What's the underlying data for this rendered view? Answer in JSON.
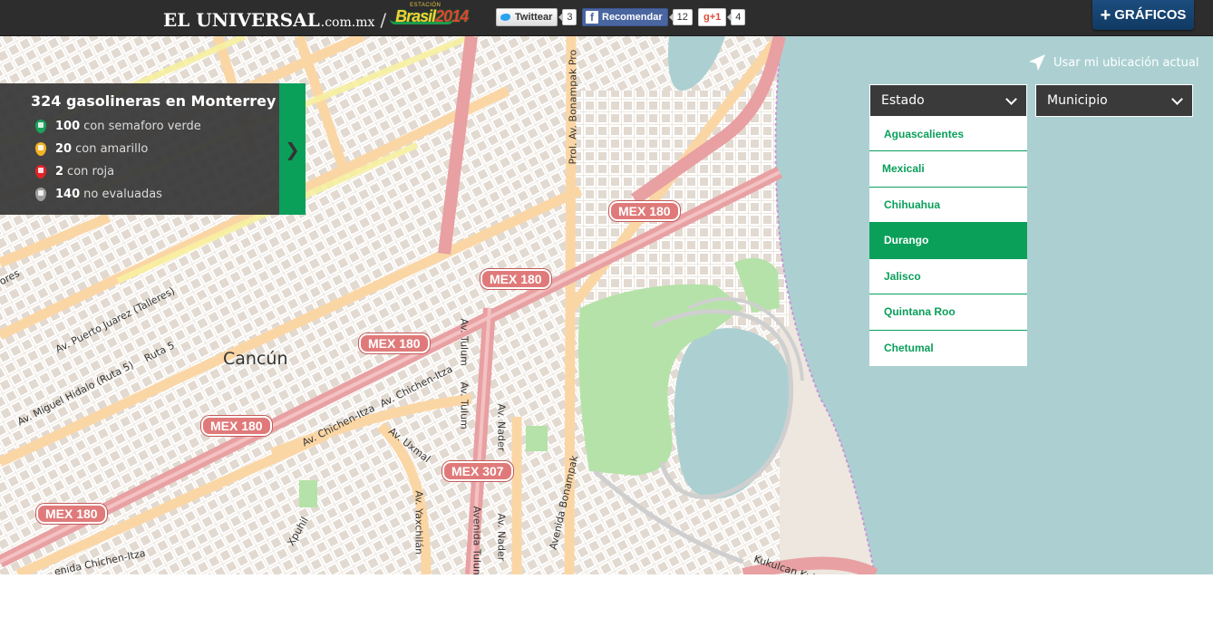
{
  "header": {
    "brand_name": "EL UNIVERSAL",
    "brand_domain": ".com.mx",
    "separator": "/",
    "logo_small": "ESTACIÓN",
    "logo_word": "Brasil",
    "logo_year": "2014",
    "twitter_label": "Twittear",
    "twitter_count": "3",
    "facebook_label": "Recomendar",
    "facebook_count": "12",
    "gplus_label": "g+1",
    "gplus_count": "4",
    "graficos_label": "GRÁFICOS"
  },
  "stats": {
    "title": "324 gasolineras en Monterrey",
    "rows": [
      {
        "count": "100",
        "label": "con semaforo verde",
        "color": "#1aa35b"
      },
      {
        "count": "20",
        "label": "con amarillo",
        "color": "#f0b323"
      },
      {
        "count": "2",
        "label": "con roja",
        "color": "#e1242a"
      },
      {
        "count": "140",
        "label": "no evaluadas",
        "color": "#9d9d9d"
      }
    ],
    "toggle": "❯"
  },
  "location": {
    "label": "Usar mi ubicación actual"
  },
  "selects": {
    "estado": "Estado",
    "municipio": "Municipio",
    "options": [
      "Aguascalientes",
      "Mexicali",
      "Chihuahua",
      "Durango",
      "Jalisco",
      "Quintana Roo",
      "Chetumal"
    ],
    "selected": "Durango"
  },
  "map": {
    "city": "Cancún",
    "shields": [
      "MEX 180",
      "MEX 180",
      "MEX 180",
      "MEX 180",
      "MEX 180",
      "MEX 307"
    ],
    "streets": {
      "puerto_juarez": "Av. Puerto Juarez (Talleres)",
      "hidalgo": "Av. Miguel Hidalo (Ruta 5)",
      "ruta5": "Ruta 5",
      "chichen1": "Av. Chichen-Itza",
      "chichen2": "Av. Chichen-Itza",
      "chichen3": "enida Chichen-Itza",
      "uxmal": "Av. Uxmal",
      "tulum1": "Av. Tulum",
      "tulum2": "Av. Tulum",
      "tulum3": "Avenida Tulum",
      "nader1": "Av. Nader",
      "nader2": "Av. Nader",
      "bonampak1": "Prol. Av. Bonampak Pro",
      "bonampak2": "Avenida Bonampak",
      "yaxchilan": "Av. Yaxchilán",
      "xpuhil": "Xpuhil",
      "kukulcan": "Kukulcan Kukulcan",
      "ores": "ores"
    },
    "colors": {
      "land": "#ede7df",
      "water": "#acd0d2",
      "highway": "#e8a0a2",
      "road": "#fbd6a5",
      "park": "#b5e2a8"
    }
  }
}
